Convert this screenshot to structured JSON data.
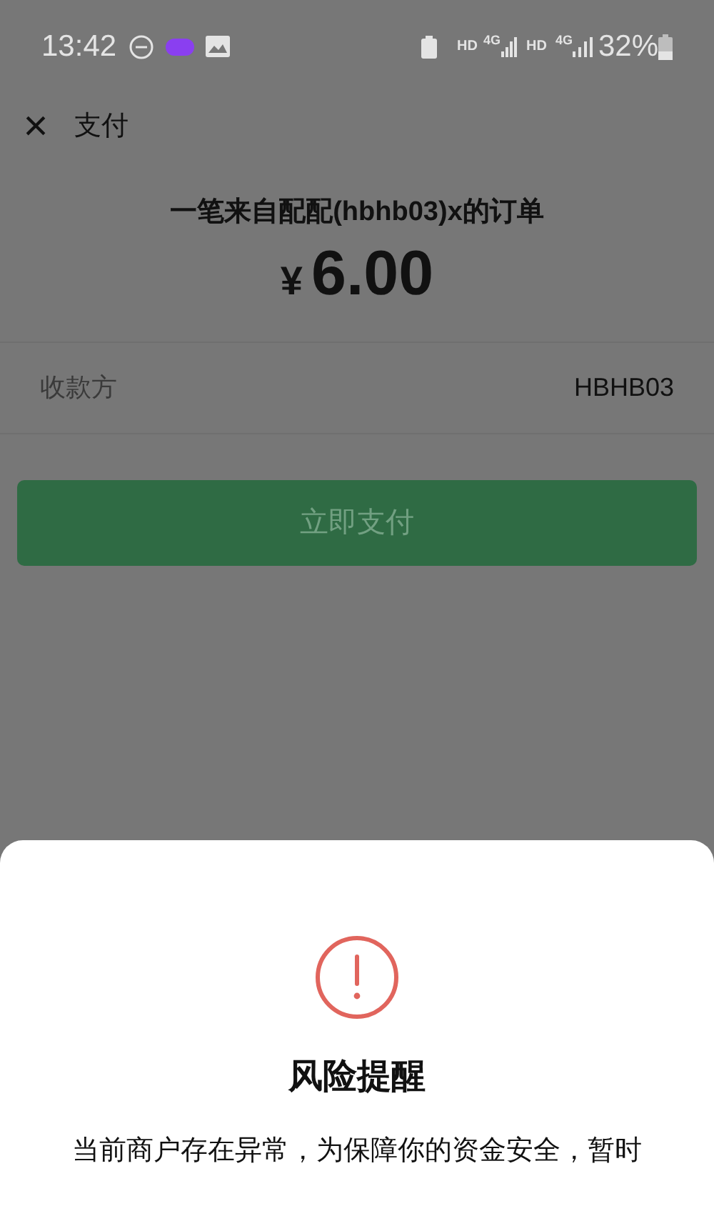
{
  "status_bar": {
    "time": "13:42",
    "net_1": "HD",
    "net_1_type": "4G",
    "net_2": "HD",
    "net_2_type": "4G",
    "battery": "32%"
  },
  "header": {
    "close": "×",
    "title": "支付"
  },
  "order": {
    "title": "一笔来自配配(hbhb03)x的订单",
    "currency": "¥",
    "amount": "6.00"
  },
  "payee": {
    "label": "收款方",
    "value": "HBHB03"
  },
  "pay_button": {
    "label": "立即支付",
    "disabled": true
  },
  "dialog": {
    "title": "风险提醒",
    "message": "当前商户存在异常，为保障你的资金安全，暂时"
  }
}
